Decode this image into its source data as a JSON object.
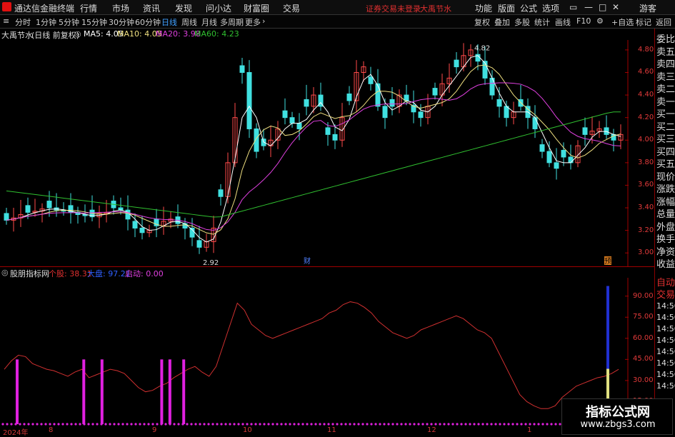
{
  "app": {
    "name": "通达信金融终端",
    "logo_color": "#e01010"
  },
  "menu": [
    "行情",
    "市场",
    "资讯",
    "发现",
    "问小达",
    "财富圈",
    "交易"
  ],
  "status_link": "证券交易未登录",
  "stock_title": "大禹节水",
  "top_right": [
    "功能",
    "版面",
    "公式",
    "选项"
  ],
  "guest": "游客",
  "periods": [
    "分时",
    "1分钟",
    "5分钟",
    "15分钟",
    "30分钟",
    "60分钟",
    "日线",
    "周线",
    "月线",
    "多周期",
    "更多"
  ],
  "active_period": "日线",
  "tools": [
    "复权",
    "叠加",
    "多股",
    "统计",
    "画线",
    "F10",
    "+自选",
    "标记",
    "返回"
  ],
  "info": {
    "name": "大禹节水",
    "desc": "(日线 前复权)",
    "ma5": "MA5: 4.05",
    "ma10": "MA10: 4.05",
    "ma20": "MA20: 3.98",
    "ma60": "MA60: 4.23"
  },
  "ma_colors": {
    "ma5": "#ffffff",
    "ma10": "#f0e080",
    "ma20": "#e040e0",
    "ma60": "#30c030"
  },
  "price_labels": [
    "4.80",
    "4.60",
    "4.40",
    "4.20",
    "4.00",
    "3.80",
    "3.60",
    "3.40",
    "3.20",
    "3.00"
  ],
  "high_label": "4.82",
  "low_label": "2.92",
  "event_markers": [
    "财",
    "预"
  ],
  "indicator": {
    "name": "股朋指标网",
    "p1": "个股: 38.31",
    "p2": "大盘: 97.21",
    "p3": "启动: 0.00"
  },
  "ind_labels": [
    "90.00",
    "75.00",
    "60.00",
    "45.00",
    "30.00",
    "15.00"
  ],
  "x_labels": [
    "2024年",
    "8",
    "9",
    "10",
    "11",
    "12",
    "1"
  ],
  "right_panel": [
    "委比",
    "卖五",
    "卖四",
    "卖三",
    "卖二",
    "卖一",
    "买一",
    "买二",
    "买三",
    "买四",
    "买五",
    "现价",
    "涨跌",
    "涨幅",
    "总量",
    "外盘",
    "换手",
    "净资",
    "收益"
  ],
  "right_panel_bottom": [
    "自动",
    "交易"
  ],
  "time_list": [
    "14:56",
    "14:56",
    "14:56",
    "14:56",
    "14:56",
    "14:56",
    "14:56",
    "14:56"
  ],
  "watermark": {
    "line1": "指标公式网",
    "line2": "www.zbgs3.com"
  },
  "chart_data": {
    "type": "candlestick",
    "title": "大禹节水",
    "ylim": [
      2.9,
      4.85
    ],
    "indicator_ylim": [
      0,
      100
    ],
    "ohlc_close_trend": [
      3.29,
      3.31,
      3.34,
      3.36,
      3.37,
      3.39,
      3.4,
      3.38,
      3.37,
      3.36,
      3.34,
      3.33,
      3.32,
      3.35,
      3.36,
      3.4,
      3.38,
      3.3,
      3.22,
      3.18,
      3.2,
      3.24,
      3.28,
      3.3,
      3.26,
      3.22,
      3.14,
      3.05,
      3.1,
      3.22,
      3.5,
      3.8,
      4.2,
      4.6,
      4.1,
      3.9,
      3.95,
      4.0,
      4.1,
      4.2,
      4.15,
      4.1,
      4.3,
      4.4,
      4.3,
      4.05,
      4.0,
      4.2,
      4.35,
      4.6,
      4.65,
      4.5,
      4.3,
      4.2,
      4.3,
      4.4,
      4.35,
      4.25,
      4.2,
      4.3,
      4.4,
      4.5,
      4.55,
      4.65,
      4.75,
      4.8,
      4.7,
      4.55,
      4.4,
      4.3,
      4.2,
      4.25,
      4.3,
      4.2,
      4.1,
      3.9,
      3.8,
      3.75,
      3.85,
      3.8,
      3.95,
      4.05,
      4.08,
      4.1,
      4.05,
      4.0,
      4.05
    ],
    "indicator_line": [
      38,
      44,
      48,
      47,
      42,
      40,
      38,
      37,
      35,
      33,
      36,
      38,
      32,
      34,
      36,
      38,
      37,
      35,
      30,
      25,
      22,
      23,
      26,
      28,
      32,
      35,
      38,
      40,
      36,
      33,
      40,
      55,
      70,
      85,
      80,
      70,
      66,
      62,
      60,
      62,
      64,
      66,
      68,
      70,
      72,
      74,
      78,
      80,
      84,
      86,
      85,
      82,
      78,
      72,
      68,
      64,
      62,
      60,
      62,
      66,
      68,
      70,
      72,
      74,
      76,
      74,
      70,
      66,
      64,
      60,
      50,
      40,
      30,
      20,
      15,
      12,
      10,
      10,
      12,
      18,
      22,
      26,
      28,
      30,
      32,
      33,
      35,
      38
    ],
    "indicator_bars": [
      {
        "x": 0.025,
        "v": 45
      },
      {
        "x": 0.131,
        "v": 45
      },
      {
        "x": 0.16,
        "v": 45
      },
      {
        "x": 0.255,
        "v": 45
      },
      {
        "x": 0.268,
        "v": 45
      },
      {
        "x": 0.29,
        "v": 45
      }
    ]
  }
}
